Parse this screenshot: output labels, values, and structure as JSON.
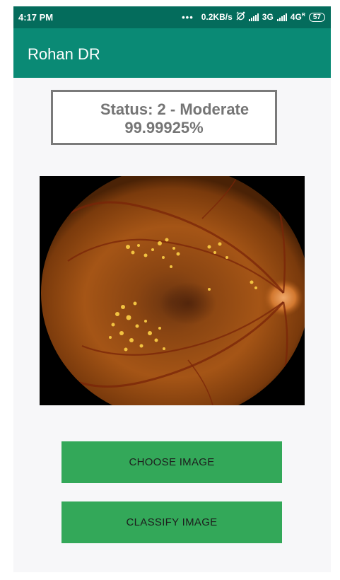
{
  "status_bar": {
    "time": "4:17 PM",
    "dots": "•••",
    "speed": "0.2KB/s",
    "net1": "3G",
    "net2": "4G",
    "net2_sup": "R",
    "battery": "57"
  },
  "app_bar": {
    "title": "Rohan DR"
  },
  "result": {
    "status_text": "Status: 2 - Moderate",
    "confidence_text": "99.99925%"
  },
  "buttons": {
    "choose_label": "Choose Image",
    "classify_label": "Classify Image"
  },
  "colors": {
    "status_bar": "#046c5c",
    "app_bar": "#0a8a75",
    "button": "#33a859",
    "result_text": "#757575"
  }
}
